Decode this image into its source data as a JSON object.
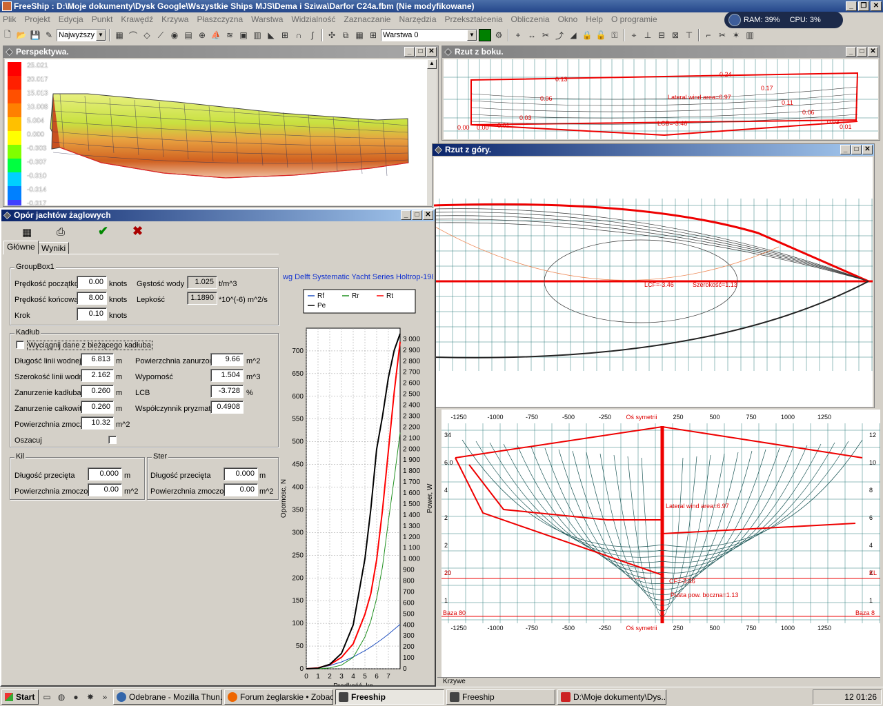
{
  "app": {
    "title": "FreeShip  : D:\\Moje dokumenty\\Dysk Google\\Wszystkie Ships MJS\\Dema i Sziwa\\Darfor C24a.fbm (Nie modyfikowane)"
  },
  "menu": [
    "Plik",
    "Projekt",
    "Edycja",
    "Punkt",
    "Krawędź",
    "Krzywa",
    "Płaszczyzna",
    "Warstwa",
    "Widzialność",
    "Zaznaczanie",
    "Narzędzia",
    "Przekształcenia",
    "Obliczenia",
    "Okno",
    "Help",
    "O programie"
  ],
  "sysmon": {
    "ram": "RAM: 39%",
    "cpu": "CPU: 3%"
  },
  "toolbar": {
    "precision": "Najwyższy",
    "layer": "Warstwa 0",
    "layer_color": "#008000"
  },
  "perspective": {
    "title": "Perspektywa.",
    "legend": [
      "25.021",
      "20.017",
      "15.013",
      "10.008",
      "5.004",
      "0.000",
      "-0.003",
      "-0.007",
      "-0.010",
      "-0.014",
      "-0.017"
    ],
    "legend_colors": [
      "#ff0000",
      "#ff2000",
      "#ff5000",
      "#ff8000",
      "#ffc000",
      "#ffff00",
      "#80ff00",
      "#00ff40",
      "#00d0ff",
      "#0080ff",
      "#4040ff"
    ]
  },
  "side_view": {
    "title": "Rzut z boku.",
    "labels": [
      "Lateral wind area=6.97",
      "LCB=-3.46",
      "0.24",
      "0.17",
      "0.11",
      "0.06",
      "0.03",
      "0.01",
      "0.00",
      "0.00",
      "0.01",
      "0.03",
      "0.06",
      "0.13",
      "0.20"
    ]
  },
  "top_view": {
    "title": "Rzut z góry.",
    "labels": [
      "LCF=-3.46",
      "Szerokość=1.13"
    ]
  },
  "body_view": {
    "x_ticks": [
      "-1250",
      "-1000",
      "-750",
      "-500",
      "-250",
      "Oś symetrii",
      "250",
      "500",
      "750",
      "1000",
      "1250"
    ],
    "lateral": "Lateral wind area=6.97",
    "cf": "CF=-3.46",
    "area": "Pusta pow. boczna=1.13",
    "baza_left": "Baza 80",
    "baza_right": "Baza 8",
    "kl_left": "20",
    "kl_right": "KL",
    "y_left": [
      "34",
      "6.0",
      "4",
      "2",
      "2",
      "20",
      "1"
    ],
    "y_right": [
      "12",
      "10",
      "8",
      "6",
      "4",
      "2",
      "1"
    ]
  },
  "status_bar": {
    "label": "Krzywe"
  },
  "resistance": {
    "title": "Opór jachtów żaglowych",
    "tabs": [
      "Główne",
      "Wyniki"
    ],
    "group1": {
      "title": "GroupBox1",
      "speed_start_label": "Prędkość początkowa",
      "speed_start": "0.00",
      "speed_end_label": "Prędkość końcowa",
      "speed_end": "8.00",
      "step_label": "Krok",
      "step": "0.10",
      "knots": "knots",
      "density_label": "Gęstość wody",
      "density": "1.025",
      "density_unit": "t/m^3",
      "viscosity_label": "Lepkość",
      "viscosity": "1.1890",
      "viscosity_unit": "*10^(-6) m^2/s"
    },
    "hull": {
      "title": "Kadłub",
      "extract_label": "Wyciągnij dane z bieżącego kadłuba",
      "lwl_label": "Długość linii wodnej",
      "lwl": "6.813",
      "bwl_label": "Szerokość linii wodnej",
      "bwl": "2.162",
      "draft_label": "Zanurzenie kadłuba",
      "draft": "0.260",
      "total_draft_label": "Zanurzenie całkowite",
      "total_draft": "0.260",
      "wetted_label": "Powierzchnia zmoczona",
      "wetted": "10.32",
      "wetted_unit": "m^2",
      "m": "m",
      "sub_area_label": "Powierzchnia zanurzona",
      "sub_area": "9.66",
      "sub_area_unit": "m^2",
      "disp_label": "Wyporność",
      "disp": "1.504",
      "disp_unit": "m^3",
      "lcb_label": "LCB",
      "lcb": "-3.728",
      "lcb_unit": "%",
      "cp_label": "Współczynnik pryzmatyczny",
      "cp": "0.4908",
      "estimate_label": "Oszacuj"
    },
    "keel": {
      "title": "Kil",
      "len_label": "Długość przecięta",
      "len": "0.000",
      "area_label": "Powierzchnia zmoczona",
      "area": "0.00",
      "m": "m",
      "m2": "m^2"
    },
    "rudder": {
      "title": "Ster",
      "len_label": "Długość przecięta",
      "len": "0.000",
      "area_label": "Powierzchnia zmoczona",
      "area": "0.00",
      "m": "m",
      "m2": "m^2"
    }
  },
  "chart_data": {
    "type": "line",
    "title": "wg Delft Systematic Yacht Series Holtrop-198",
    "xlabel": "Prędkość, kn",
    "ylabel": "Opornosc, N",
    "y2label": "Power, W",
    "x_ticks": [
      "0",
      "1",
      "2",
      "3",
      "4",
      "5",
      "6",
      "7"
    ],
    "y_ticks": [
      "0",
      "50",
      "100",
      "150",
      "200",
      "250",
      "300",
      "350",
      "400",
      "450",
      "500",
      "550",
      "600",
      "650",
      "700"
    ],
    "y2_ticks": [
      "0",
      "100",
      "200",
      "300",
      "400",
      "500",
      "600",
      "700",
      "800",
      "900",
      "1 000",
      "1 100",
      "1 200",
      "1 300",
      "1 400",
      "1 500",
      "1 600",
      "1 700",
      "1 800",
      "1 900",
      "2 000",
      "2 100",
      "2 200",
      "2 300",
      "2 400",
      "2 500",
      "2 600",
      "2 700",
      "2 800",
      "2 900",
      "3 000"
    ],
    "xlim": [
      0,
      8
    ],
    "ylim": [
      0,
      750
    ],
    "y2lim": [
      0,
      3100
    ],
    "x": [
      0,
      1,
      2,
      3,
      4,
      5,
      5.5,
      6,
      6.5,
      7,
      7.5,
      8
    ],
    "series": [
      {
        "name": "Rf",
        "color": "#2050c0",
        "axis": "left",
        "values": [
          0,
          2,
          7,
          15,
          26,
          40,
          48,
          57,
          66,
          76,
          87,
          98
        ]
      },
      {
        "name": "Rr",
        "color": "#209020",
        "axis": "left",
        "values": [
          0,
          0,
          2,
          8,
          25,
          70,
          105,
          155,
          225,
          325,
          420,
          520
        ]
      },
      {
        "name": "Rt",
        "color": "#ff0000",
        "axis": "left",
        "values": [
          0,
          2,
          9,
          25,
          55,
          120,
          165,
          240,
          350,
          480,
          610,
          720
        ]
      },
      {
        "name": "Pe",
        "color": "#000000",
        "axis": "right",
        "values": [
          0,
          5,
          40,
          140,
          400,
          1000,
          1450,
          2000,
          2300,
          2650,
          2900,
          3050
        ]
      }
    ]
  },
  "taskbar": {
    "start": "Start",
    "tasks": [
      "Odebrane - Mozilla Thun...",
      "Forum żeglarskie • Zobac...",
      "Freeship",
      "Freeship",
      "D:\\Moje dokumenty\\Dys..."
    ],
    "clock": "01:26",
    "tray_num": "12"
  }
}
